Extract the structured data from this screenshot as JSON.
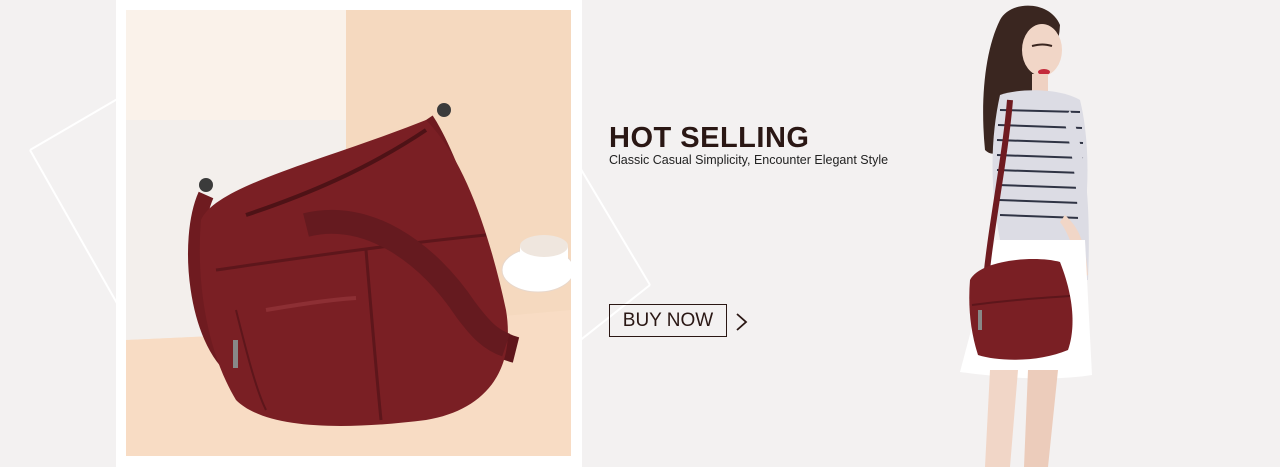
{
  "banner": {
    "headline": "HOT SELLING",
    "subline": "Classic Casual Simplicity, Encounter Elegant Style",
    "cta_label": "BUY NOW",
    "cta_icon": "chevron-right-icon",
    "colors": {
      "background": "#f3f1f1",
      "text_dark": "#2a1714",
      "bag_red": "#7a1f24"
    }
  }
}
